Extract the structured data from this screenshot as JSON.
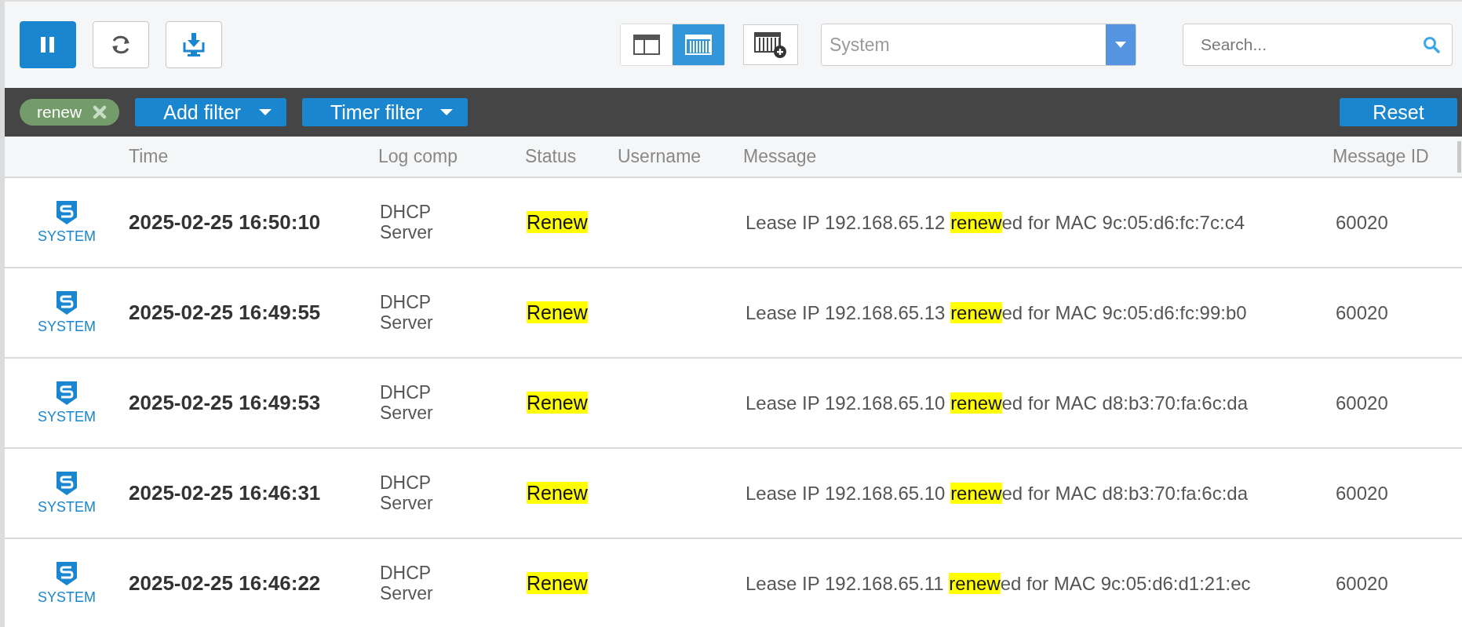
{
  "toolbar": {
    "paused": true,
    "view_modes": [
      {
        "kind": "panes",
        "selected": false
      },
      {
        "kind": "columns",
        "selected": true
      }
    ],
    "source_select": {
      "value": "System"
    },
    "search": {
      "placeholder": "Search..."
    }
  },
  "filter_bar": {
    "tags": [
      {
        "label": "renew"
      }
    ],
    "dropdowns": [
      {
        "label": "Add filter"
      },
      {
        "label": "Timer filter"
      }
    ],
    "reset": "Reset"
  },
  "table": {
    "columns": [
      "Time",
      "Log comp",
      "Status",
      "Username",
      "Message",
      "Message ID"
    ],
    "rows": [
      {
        "source": "SYSTEM",
        "time": "2025-02-25 16:50:10",
        "log_comp": "DHCP Server",
        "status": {
          "text": "Renew",
          "highlighted": true
        },
        "username": "",
        "message": [
          {
            "text": "Lease IP 192.168.65.12 ",
            "highlighted": false
          },
          {
            "text": "renew",
            "highlighted": true
          },
          {
            "text": "ed for MAC 9c:05:d6:fc:7c:c4",
            "highlighted": false
          }
        ],
        "message_id": "60020"
      },
      {
        "source": "SYSTEM",
        "time": "2025-02-25 16:49:55",
        "log_comp": "DHCP Server",
        "status": {
          "text": "Renew",
          "highlighted": true
        },
        "username": "",
        "message": [
          {
            "text": "Lease IP 192.168.65.13 ",
            "highlighted": false
          },
          {
            "text": "renew",
            "highlighted": true
          },
          {
            "text": "ed for MAC 9c:05:d6:fc:99:b0",
            "highlighted": false
          }
        ],
        "message_id": "60020"
      },
      {
        "source": "SYSTEM",
        "time": "2025-02-25 16:49:53",
        "log_comp": "DHCP Server",
        "status": {
          "text": "Renew",
          "highlighted": true
        },
        "username": "",
        "message": [
          {
            "text": "Lease IP 192.168.65.10 ",
            "highlighted": false
          },
          {
            "text": "renew",
            "highlighted": true
          },
          {
            "text": "ed for MAC d8:b3:70:fa:6c:da",
            "highlighted": false
          }
        ],
        "message_id": "60020"
      },
      {
        "source": "SYSTEM",
        "time": "2025-02-25 16:46:31",
        "log_comp": "DHCP Server",
        "status": {
          "text": "Renew",
          "highlighted": true
        },
        "username": "",
        "message": [
          {
            "text": "Lease IP 192.168.65.10 ",
            "highlighted": false
          },
          {
            "text": "renew",
            "highlighted": true
          },
          {
            "text": "ed for MAC d8:b3:70:fa:6c:da",
            "highlighted": false
          }
        ],
        "message_id": "60020"
      },
      {
        "source": "SYSTEM",
        "time": "2025-02-25 16:46:22",
        "log_comp": "DHCP Server",
        "status": {
          "text": "Renew",
          "highlighted": true
        },
        "username": "",
        "message": [
          {
            "text": "Lease IP 192.168.65.11 ",
            "highlighted": false
          },
          {
            "text": "renew",
            "highlighted": true
          },
          {
            "text": "ed for MAC 9c:05:d6:d1:21:ec",
            "highlighted": false
          }
        ],
        "message_id": "60020"
      }
    ]
  }
}
